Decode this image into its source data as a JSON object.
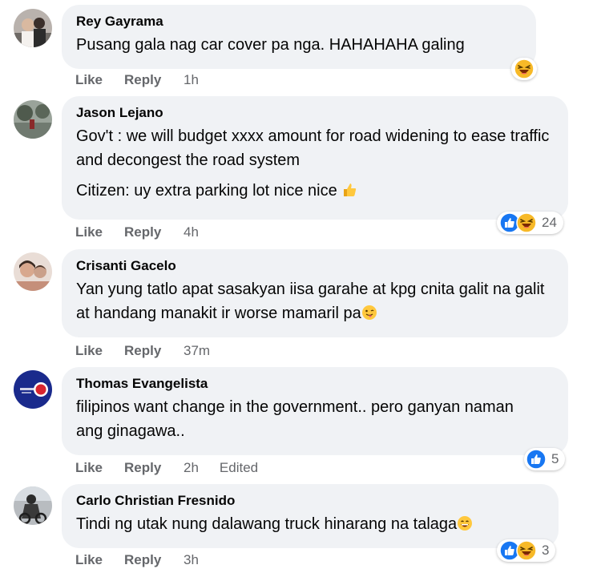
{
  "comments": [
    {
      "author": "Rey Gayrama",
      "paragraphs": [
        "Pusang gala nag car cover pa nga. HAHAHAHA galing"
      ],
      "like": "Like",
      "reply": "Reply",
      "time": "1h",
      "reaction_icons": [
        "laugh-reaction"
      ]
    },
    {
      "author": "Jason Lejano",
      "paragraphs": [
        "Gov't : we will budget xxxx amount for road widening to ease traffic and decongest the road system",
        "Citizen: uy extra parking lot nice nice"
      ],
      "like": "Like",
      "reply": "Reply",
      "time": "4h",
      "reaction_icons": [
        "like-reaction",
        "laugh-reaction"
      ],
      "reaction_count": "24"
    },
    {
      "author": "Crisanti Gacelo",
      "paragraphs": [
        "Yan yung tatlo apat sasakyan iisa garahe at kpg cnita galit na galit at handang manakit ir worse mamaril pa"
      ],
      "like": "Like",
      "reply": "Reply",
      "time": "37m"
    },
    {
      "author": "Thomas Evangelista",
      "paragraphs": [
        "filipinos want change in the government.. pero ganyan naman ang ginagawa.."
      ],
      "like": "Like",
      "reply": "Reply",
      "time": "2h",
      "edited": "Edited",
      "reaction_icons": [
        "like-reaction"
      ],
      "reaction_count": "5"
    },
    {
      "author": "Carlo Christian Fresnido",
      "paragraphs": [
        "Tindi ng utak nung dalawang truck hinarang na talaga"
      ],
      "like": "Like",
      "reply": "Reply",
      "time": "3h",
      "reaction_icons": [
        "like-reaction",
        "laugh-reaction"
      ],
      "reaction_count": "3"
    }
  ],
  "colors": {
    "bubble": "#f0f2f5",
    "secondary_text": "#65676b",
    "like_blue": "#1877f2",
    "laugh_yellow": "#f7b928"
  }
}
